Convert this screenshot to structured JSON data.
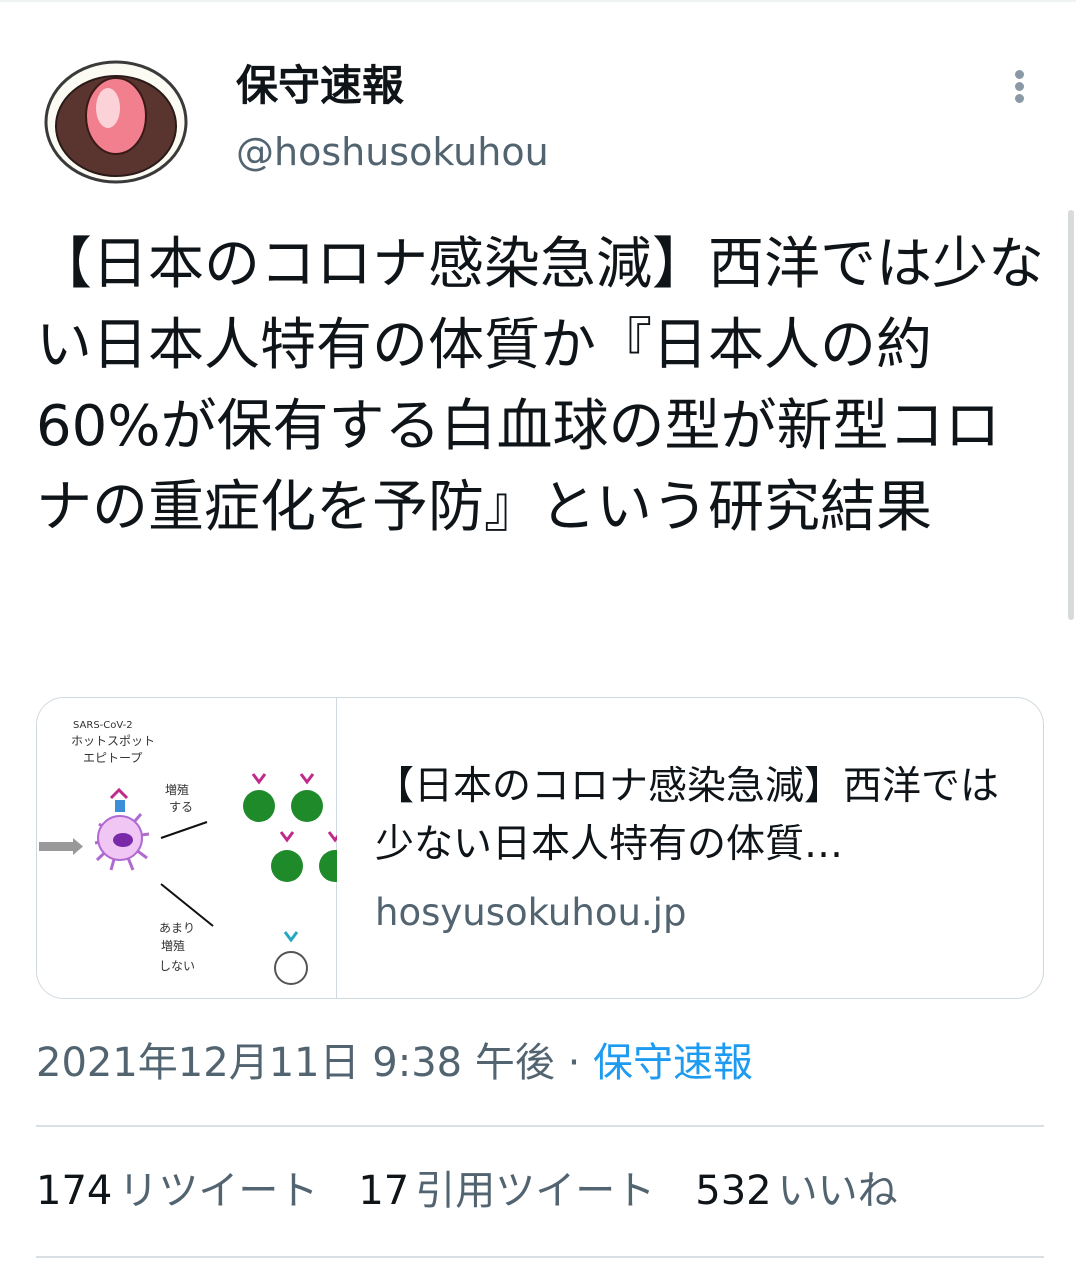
{
  "author": {
    "display_name": "保守速報",
    "handle": "@hoshusokuhou",
    "avatar_icon": "ichigo-daifuku-icon"
  },
  "tweet": {
    "text": "【日本のコロナ感染急減】西洋では少ない日本人特有の体質か『日本人の約60%が保有する白血球の型が新型コロナの重症化を予防』という研究結果"
  },
  "card": {
    "title": "【日本のコロナ感染急減】西洋では少ない日本人特有の体質…",
    "domain": "hosyusokuhou.jp",
    "thumbnail": {
      "hotspot_label_1": "SARS-CoV-2",
      "hotspot_label_2": "ホットスポット",
      "hotspot_label_3": "エピトープ",
      "proliferate_1": "増殖",
      "proliferate_2": "する",
      "rarely_1": "あまり",
      "rarely_2": "増殖",
      "rarely_3": "しない"
    }
  },
  "meta": {
    "timestamp": "2021年12月11日 9:38 午後",
    "separator": " · ",
    "source": "保守速報"
  },
  "stats": {
    "retweets_count": "174",
    "retweets_label": "リツイート",
    "quotes_count": "17",
    "quotes_label": "引用ツイート",
    "likes_count": "532",
    "likes_label": "いいね"
  },
  "colors": {
    "text": "#0f1419",
    "secondary": "#536471",
    "link": "#1d9bf0",
    "border": "#cfd9de"
  }
}
